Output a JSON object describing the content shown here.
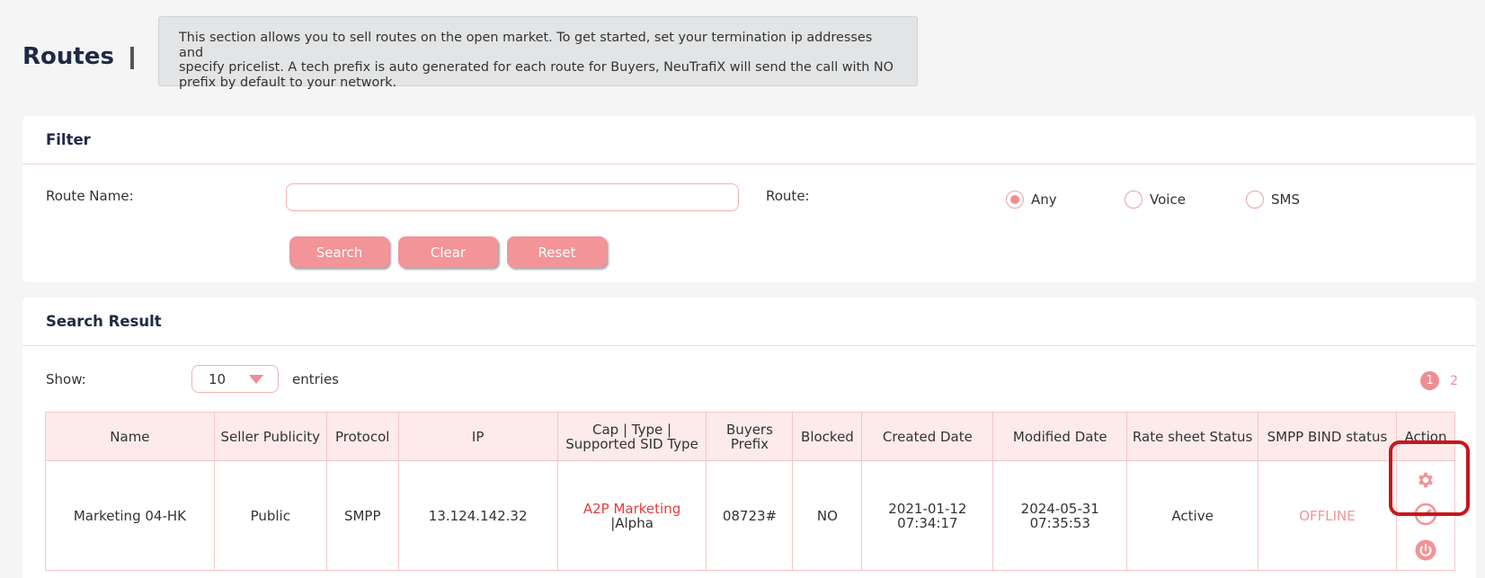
{
  "page": {
    "title": "Routes",
    "info_lines": [
      "This section allows you to sell routes on the open market. To get started, set your termination ip addresses and",
      "specify pricelist. A tech prefix is auto generated for each route for Buyers, NeuTrafiX will send the call with NO",
      "prefix by default to your network."
    ]
  },
  "filter": {
    "heading": "Filter",
    "route_name_label": "Route Name:",
    "route_name_value": "",
    "route_label": "Route:",
    "route_options": [
      {
        "label": "Any",
        "selected": true
      },
      {
        "label": "Voice",
        "selected": false
      },
      {
        "label": "SMS",
        "selected": false
      }
    ],
    "buttons": {
      "search": "Search",
      "clear": "Clear",
      "reset": "Reset"
    }
  },
  "results": {
    "heading": "Search Result",
    "show_label": "Show:",
    "entries_value": "10",
    "entries_label": "entries",
    "pagination": {
      "current": "1",
      "next": "2"
    },
    "columns": [
      "Name",
      "Seller Publicity",
      "Protocol",
      "IP",
      "Cap | Type | Supported SID Type",
      "Buyers Prefix",
      "Blocked",
      "Created Date",
      "Modified Date",
      "Rate sheet Status",
      "SMPP BIND status",
      "Action"
    ],
    "rows": [
      {
        "name": "Marketing 04-HK",
        "publicity": "Public",
        "protocol": "SMPP",
        "ip": "13.124.142.32",
        "cap_type": "A2P Marketing",
        "sid_type": "|Alpha",
        "buyers_prefix": "08723#",
        "blocked": "NO",
        "created_date": "2021-01-12",
        "created_time": "07:34:17",
        "modified_date": "2024-05-31",
        "modified_time": "07:35:53",
        "rate_status": "Active",
        "smpp_status": "OFFLINE"
      }
    ]
  },
  "colors": {
    "accent": "#f29498",
    "highlight": "#c8161d",
    "cap_red": "#e53b3b"
  },
  "icons": [
    "gear-icon",
    "link-icon",
    "power-icon",
    "chevron-down-icon"
  ]
}
